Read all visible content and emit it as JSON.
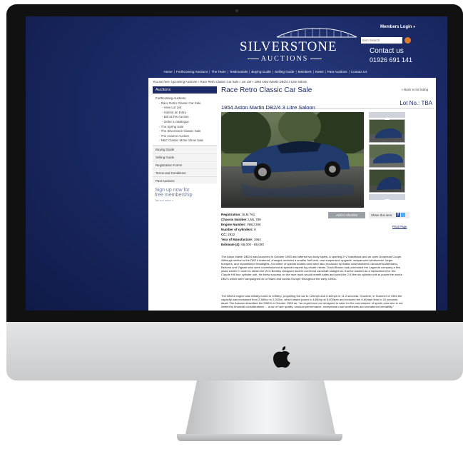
{
  "header": {
    "logo_line1": "SILVERSTONE",
    "logo_line2": "AUCTIONS",
    "members_login": "Members Login »",
    "search_placeholder": "Item Search",
    "contact_label": "Contact us",
    "phone": "01926 691 141",
    "nav": [
      "Home",
      "Forthcoming Auctions",
      "The Team",
      "Testimonials",
      "Buying Guide",
      "Selling Guide",
      "Members",
      "News",
      "Past Auctions",
      "Contact Us"
    ]
  },
  "breadcrumb": "You are here: Upcoming Auctions » Race Retro Classic Car Sale » Lot List » 1954 Aston Martin DB2/4 3 Litre Saloon",
  "sidebar": {
    "heading": "Auctions",
    "items": [
      {
        "label": "Forthcoming Auctions",
        "sub": false
      },
      {
        "label": "- Race Retro Classic Car Sale",
        "sub": true
      },
      {
        "label": "- View Lot List",
        "sub": true
      },
      {
        "label": "- Submit an Entry",
        "sub": true
      },
      {
        "label": "- Bid at this Auction",
        "sub": true
      },
      {
        "label": "- Order a catalogue",
        "sub": true
      },
      {
        "label": "- The Spring Sale",
        "sub": true
      },
      {
        "label": "- The Silverstone Classic Sale",
        "sub": true
      },
      {
        "label": "- The Autumn Auction",
        "sub": true
      },
      {
        "label": "- NEC Classic Motor Show Sale",
        "sub": true
      }
    ],
    "sections": [
      "Buying Guide",
      "Selling Guide",
      "Registration Forms",
      "Terms and Conditions",
      "Past Auctions"
    ],
    "signup_line1": "Sign up now for",
    "signup_line2": "free membership",
    "tell_more": "Tell me more »"
  },
  "main": {
    "title": "Race Retro Classic Car Sale",
    "back_link": "« Back to lot listing",
    "lot_title": "1954 Aston Martin DB2/4 3 Litre Saloon",
    "lot_no": "Lot No.: TBA",
    "details": [
      {
        "label": "Registration:",
        "value": "ULM 761"
      },
      {
        "label": "Chassis Number:",
        "value": "LML 789"
      },
      {
        "label": "Engine Number:",
        "value": "VB6J 260"
      },
      {
        "label": "Number of cylinders:",
        "value": "6"
      },
      {
        "label": "CC:",
        "value": "2922"
      },
      {
        "label": "Year of Manufacture:",
        "value": "1954"
      },
      {
        "label": "Estimate (£):",
        "value": "65,000 - 85,000"
      }
    ],
    "add_to_shortlist": "Add to Shortlist",
    "share_label": "Share this item:",
    "print_page": "Print Page",
    "paragraph1": "The Aston Martin DB2/4 was launched in October 1953 and offered two body styles. A sporting 2+2 hatchback and an open Drophead Coupe. Although similar to the DB2 it featured, changes included a smaller fuel tank, rear suspension upgrade, wraparound windscreen, larger bumpers, and repositioned headlights. A number of special bodied cars were also produced by Italian coachbuilders Carrozzeria Allemano, Bertone and Vignale who were commissioned at special request by private clients. David Brown had purchased the Lagonda company a few years earlier in order to obtain the W.O.Bentley designed double overhead camshaft straight six, that he wanted as a replacement for the Claude Hill four cylinder unit. He knew success on the race track would benefit sales and used the 2.6 litre six cylinder unit to power the works DB2's which were campaigned at Le Mans and across Europe throughout the early 1950s.",
    "paragraph2": "The DB2/4 engine was initially tuned to 105bhp, propelling the car to 120mph and 0-60mph in 11.2 seconds. However, in Summer of 1954 the capacity was increased from 2,580cc to 2,922cc, which raised power to 140bhp at 5,000rpm and reduced the 0-60mph time to 10 seconds dead. The Autocar described the DB2/4 in October 1953 as: \"an experience car designed to cater for the connoisseur of sports cars who is not limited by financial considerations ... a car of rare quality, unusual performance, exceptional road worthiness and unmatched versatility.\""
  },
  "colors": {
    "navy": "#1c2b66",
    "accent": "#e07a2b"
  }
}
